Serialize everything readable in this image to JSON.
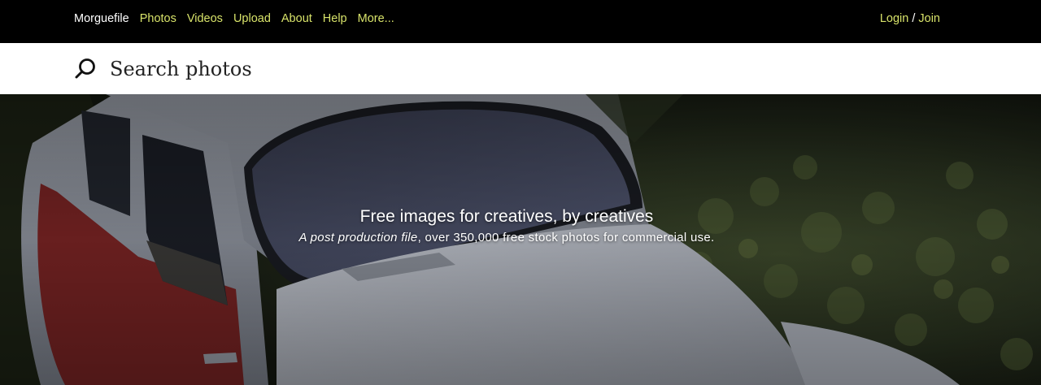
{
  "nav": {
    "brand": "Morguefile",
    "items": [
      "Photos",
      "Videos",
      "Upload",
      "About",
      "Help",
      "More..."
    ]
  },
  "auth": {
    "login": "Login",
    "separator": "/",
    "join": "Join"
  },
  "search": {
    "placeholder": "Search photos",
    "icon": "search-icon"
  },
  "hero": {
    "title": "Free images for creatives, by creatives",
    "subtitle_em": "A post production file",
    "subtitle_rest": ", over 350,000 free stock photos for commercial use."
  },
  "colors": {
    "nav_link": "#d8e36a",
    "topbar_bg": "#000000",
    "search_bg": "#ffffff"
  }
}
